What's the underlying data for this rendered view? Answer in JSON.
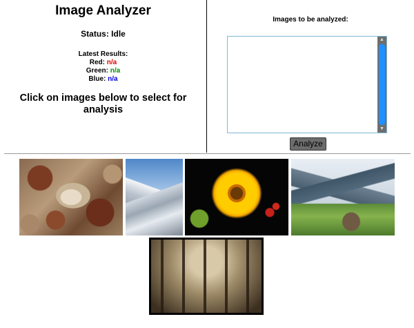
{
  "app": {
    "title": "Image Analyzer"
  },
  "status": {
    "label": "Status:",
    "value": "Idle"
  },
  "results": {
    "heading": "Latest Results:",
    "red_label": "Red:",
    "red_value": "n/a",
    "green_label": "Green:",
    "green_value": "n/a",
    "blue_label": "Blue:",
    "blue_value": "n/a"
  },
  "instruction": "Click on images below to select for analysis",
  "queue": {
    "title": "Images to be analyzed:",
    "items": []
  },
  "analyze_button": "Analyze",
  "gallery": [
    {
      "name": "seashells-image"
    },
    {
      "name": "snowy-mountain-image"
    },
    {
      "name": "sunflower-image"
    },
    {
      "name": "mountain-cabin-image"
    },
    {
      "name": "foggy-forest-image"
    }
  ],
  "colors": {
    "red": "#e00000",
    "green": "#009000",
    "blue": "#0000e0",
    "scroll_thumb": "#1e90ff"
  }
}
